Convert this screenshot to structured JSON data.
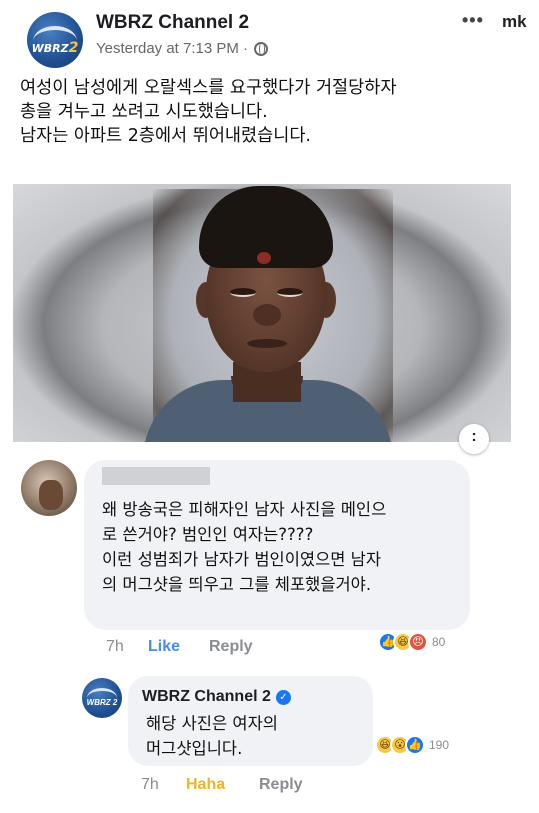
{
  "header": {
    "page_name": "WBRZ Channel 2",
    "timestamp": "Yesterday at 7:13 PM · ",
    "avatar_logo": "WBRZ",
    "avatar_logo_num": "2",
    "more_label": "•••",
    "watermark": "mk"
  },
  "post": {
    "text_lines": [
      "여성이 남성에게 오랄섹스를 요구했다가 거절당하자",
      "총을 겨누고 쏘려고 시도했습니다.",
      "남자는 아파트 2층에서 뛰어내렸습니다."
    ],
    "expand_label": ":"
  },
  "comment": {
    "text_lines": [
      "왜 방송국은 피해자인 남자 사진을 메인으",
      "로 쓴거야? 범인인 여자는????",
      "이런 성범죄가 남자가 범인이였으면 남자",
      "의 머그샷을 띄우고 그를 체포했을거야."
    ],
    "time": "7h",
    "like_label": "Like",
    "reply_label": "Reply",
    "reaction_count": "80",
    "reactions": [
      "like",
      "haha",
      "angry"
    ]
  },
  "reply": {
    "author": "WBRZ Channel 2",
    "verified_glyph": "✓",
    "avatar_logo": "WBRZ 2",
    "text_lines": [
      "해당 사진은 여자의",
      "머그샷입니다."
    ],
    "time": "7h",
    "reaction_label": "Haha",
    "reply_label": "Reply",
    "reaction_count": "190",
    "reactions": [
      "haha",
      "wow",
      "like"
    ]
  },
  "colors": {
    "facebook_blue": "#1877f2",
    "haha_yellow": "#f0b429",
    "bubble_gray": "#f0f2f5"
  }
}
